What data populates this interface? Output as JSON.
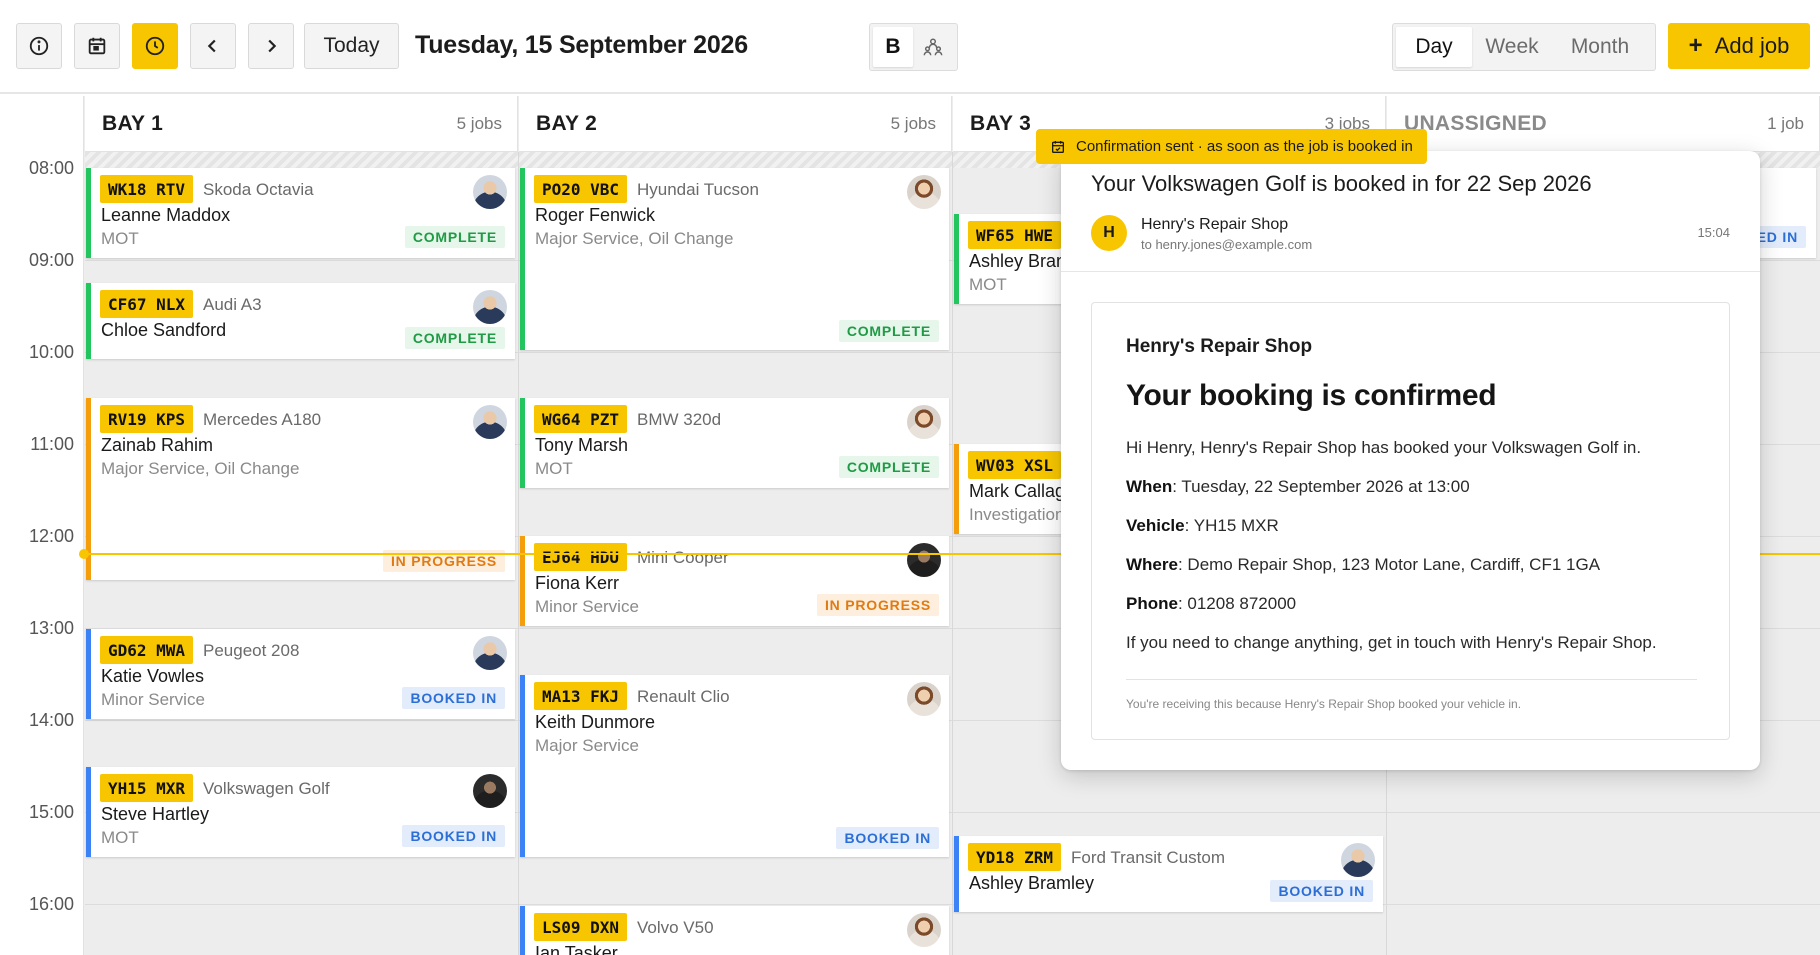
{
  "toolbar": {
    "info_icon": "info-icon",
    "calendar_icon": "calendar-icon",
    "clock_icon": "clock-icon",
    "prev_icon": "chevron-left-icon",
    "next_icon": "chevron-right-icon",
    "today_label": "Today",
    "date_title": "Tuesday, 15 September 2026",
    "bay_toggle_label": "B",
    "people_icon": "people-icon",
    "views": [
      "Day",
      "Week",
      "Month"
    ],
    "selected_view": "Day",
    "add_job_label": "Add job",
    "accent_color": "#f7c600"
  },
  "times": [
    "08:00",
    "09:00",
    "10:00",
    "11:00",
    "12:00",
    "13:00",
    "14:00",
    "15:00",
    "16:00"
  ],
  "columns": [
    {
      "name": "BAY 1",
      "count": "5 jobs"
    },
    {
      "name": "BAY 2",
      "count": "5 jobs"
    },
    {
      "name": "BAY 3",
      "count": "3 jobs"
    },
    {
      "name": "UNASSIGNED",
      "count": "1 job"
    }
  ],
  "status_colors": {
    "complete": "#22c55e",
    "in_progress": "#f59e0b",
    "booked_in": "#3b82f6"
  },
  "jobs": [
    {
      "plate": "WK18 RTV",
      "vehicle": "Skoda Octavia",
      "customer": "Leanne Maddox",
      "service": "MOT",
      "status": "COMPLETE"
    },
    {
      "plate": "CF67 NLX",
      "vehicle": "Audi A3",
      "customer": "Chloe Sandford",
      "service": "",
      "status": "COMPLETE"
    },
    {
      "plate": "RV19 KPS",
      "vehicle": "Mercedes A180",
      "customer": "Zainab Rahim",
      "service": "Major Service, Oil Change",
      "status": "IN PROGRESS"
    },
    {
      "plate": "GD62 MWA",
      "vehicle": "Peugeot 208",
      "customer": "Katie Vowles",
      "service": "Minor Service",
      "status": "BOOKED IN"
    },
    {
      "plate": "YH15 MXR",
      "vehicle": "Volkswagen Golf",
      "customer": "Steve Hartley",
      "service": "MOT",
      "status": "BOOKED IN"
    },
    {
      "plate": "PO20 VBC",
      "vehicle": "Hyundai Tucson",
      "customer": "Roger Fenwick",
      "service": "Major Service, Oil Change",
      "status": "COMPLETE"
    },
    {
      "plate": "WG64 PZT",
      "vehicle": "BMW 320d",
      "customer": "Tony Marsh",
      "service": "MOT",
      "status": "COMPLETE"
    },
    {
      "plate": "EJ64 HDU",
      "vehicle": "Mini Cooper",
      "customer": "Fiona Kerr",
      "service": "Minor Service",
      "status": "IN PROGRESS"
    },
    {
      "plate": "MA13 FKJ",
      "vehicle": "Renault Clio",
      "customer": "Keith Dunmore",
      "service": "Major Service",
      "status": "BOOKED IN"
    },
    {
      "plate": "LS09 DXN",
      "vehicle": "Volvo V50",
      "customer": "Ian Tasker",
      "service": "",
      "status": ""
    },
    {
      "plate": "WF65 HWE",
      "vehicle": "",
      "customer": "Ashley Bran",
      "service": "MOT",
      "status": ""
    },
    {
      "plate": "WV03 XSL",
      "vehicle": "",
      "customer": "Mark Callag",
      "service": "Investigation",
      "status": ""
    },
    {
      "plate": "YD18 ZRM",
      "vehicle": "Ford Transit Custom",
      "customer": "Ashley Bramley",
      "service": "",
      "status": "BOOKED IN"
    },
    {
      "plate": "",
      "vehicle": "",
      "customer": "",
      "service": "",
      "status": "ED IN"
    }
  ],
  "confirmation_banner": {
    "icon": "calendar-check-icon",
    "text": "Confirmation sent · as soon as the job is booked in"
  },
  "email": {
    "subject": "Your Volkswagen Golf is booked in for 22 Sep 2026",
    "from_initial": "H",
    "from": "Henry's Repair Shop",
    "to": "to henry.jones@example.com",
    "time": "15:04",
    "shop": "Henry's Repair Shop",
    "heading": "Your booking is confirmed",
    "intro": "Hi Henry, Henry's Repair Shop has booked your Volkswagen Golf in.",
    "when_label": "When",
    "when_value": ": Tuesday, 22 September 2026 at 13:00",
    "vehicle_label": "Vehicle",
    "vehicle_value": ": YH15 MXR",
    "where_label": "Where",
    "where_value": ": Demo Repair Shop, 123 Motor Lane, Cardiff, CF1 1GA",
    "phone_label": "Phone",
    "phone_value": ": 01208 872000",
    "closing": "If you need to change anything, get in touch with Henry's Repair Shop.",
    "footer": "You're receiving this because Henry's Repair Shop booked your vehicle in."
  }
}
